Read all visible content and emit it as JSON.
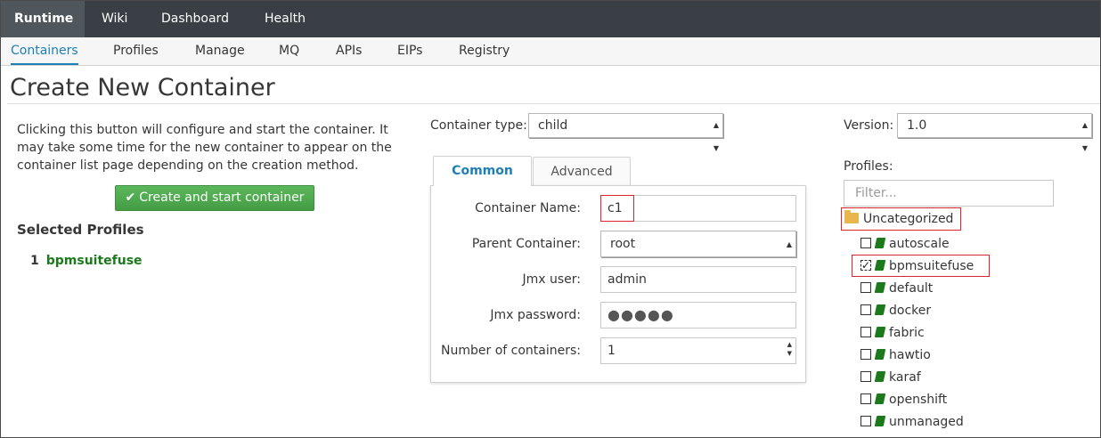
{
  "topnav": {
    "items": [
      "Runtime",
      "Wiki",
      "Dashboard",
      "Health"
    ]
  },
  "subnav": {
    "items": [
      "Containers",
      "Profiles",
      "Manage",
      "MQ",
      "APIs",
      "EIPs",
      "Registry"
    ]
  },
  "page": {
    "title": "Create New Container"
  },
  "left": {
    "description": "Clicking this button will configure and start the container. It may take some time for the new container to appear on the container list page depending on the creation method.",
    "create_button": "Create and start container",
    "selected_heading": "Selected Profiles",
    "selected_items": [
      {
        "num": "1",
        "name": "bpmsuitefuse"
      }
    ]
  },
  "middle": {
    "container_type_label": "Container type:",
    "container_type_value": "child",
    "tabs": [
      "Common",
      "Advanced"
    ],
    "fields": {
      "name_label": "Container Name:",
      "name_value": "c1",
      "parent_label": "Parent Container:",
      "parent_value": "root",
      "jmx_user_label": "Jmx user:",
      "jmx_user_value": "admin",
      "jmx_password_label": "Jmx password:",
      "jmx_password_value": "●●●●●",
      "num_containers_label": "Number of containers:",
      "num_containers_value": "1"
    }
  },
  "right": {
    "version_label": "Version:",
    "version_value": "1.0",
    "profiles_label": "Profiles:",
    "filter_placeholder": "Filter...",
    "folder_name": "Uncategorized",
    "profiles": [
      {
        "name": "autoscale",
        "checked": false
      },
      {
        "name": "bpmsuitefuse",
        "checked": true
      },
      {
        "name": "default",
        "checked": false
      },
      {
        "name": "docker",
        "checked": false
      },
      {
        "name": "fabric",
        "checked": false
      },
      {
        "name": "hawtio",
        "checked": false
      },
      {
        "name": "karaf",
        "checked": false
      },
      {
        "name": "openshift",
        "checked": false
      },
      {
        "name": "unmanaged",
        "checked": false
      }
    ]
  },
  "colors": {
    "topnav_bg": "#393f44",
    "accent_blue": "#1d7fb5",
    "button_green": "#5cb85c",
    "highlight_red": "#d9262c",
    "profile_green": "#1c7a1c"
  }
}
